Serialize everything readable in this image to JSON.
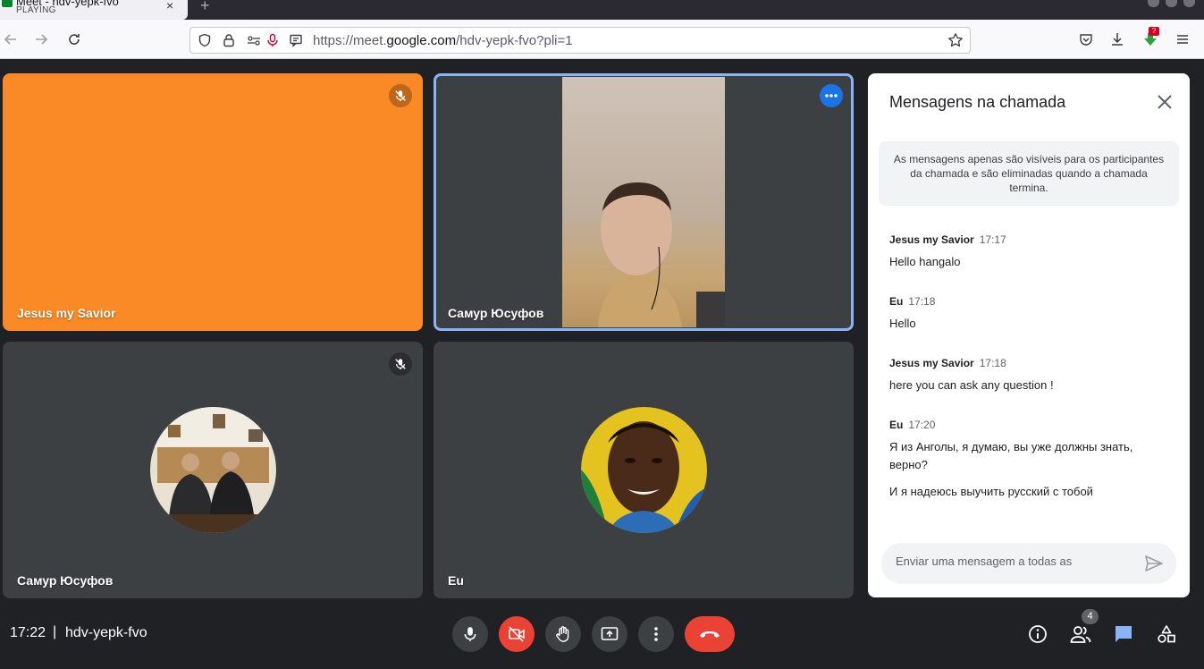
{
  "browser": {
    "tab_title": "Meet - hdv-yepk-fvo",
    "tab_status": "PLAYING",
    "url_prefix": "https://meet.",
    "url_host": "google.com",
    "url_path": "/hdv-yepk-fvo?pli=1",
    "download_badge": "?"
  },
  "tiles": [
    {
      "name": "Jesus my Savior",
      "color": "#fa8a26"
    },
    {
      "name": "Самур Юсуфов"
    },
    {
      "name": "Самур Юсуфов"
    },
    {
      "name": "Eu"
    }
  ],
  "chat": {
    "title": "Mensagens na chamada",
    "info": "As mensagens apenas são visíveis para os participantes da chamada e são eliminadas quando a chamada termina.",
    "messages": [
      {
        "sender": "Jesus my Savior",
        "time": "17:17",
        "lines": [
          "Hello hangalo"
        ]
      },
      {
        "sender": "Eu",
        "time": "17:18",
        "lines": [
          "Hello"
        ]
      },
      {
        "sender": "Jesus my Savior",
        "time": "17:18",
        "lines": [
          "here you can ask any question !"
        ]
      },
      {
        "sender": "Eu",
        "time": "17:20",
        "lines": [
          "Я из Анголы, я думаю, вы уже должны знать, верно?",
          "И я надеюсь выучить русский с тобой"
        ]
      }
    ],
    "input_placeholder": "Enviar uma mensagem a todas as"
  },
  "meeting": {
    "time": "17:22",
    "separator": "|",
    "code": "hdv-yepk-fvo",
    "participants_count": "4"
  },
  "colors": {
    "accent": "#1a73e8",
    "danger": "#ea4335",
    "tile_bg": "#3c4043",
    "page_bg": "#202124"
  }
}
